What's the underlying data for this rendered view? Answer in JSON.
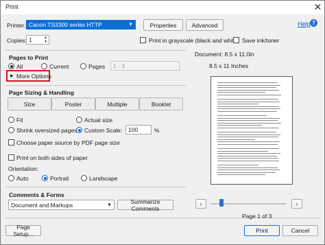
{
  "window": {
    "title": "Print",
    "close_icon": "close-icon"
  },
  "printer": {
    "label": "Printer:",
    "selected": "Canon TS3300 series HTTP",
    "properties_label": "Properties",
    "advanced_label": "Advanced",
    "help_label": "Help"
  },
  "copies": {
    "label": "Copies:",
    "value": "1",
    "grayscale_label": "Print in grayscale (black and white)",
    "save_ink_label": "Save ink/toner"
  },
  "pages_to_print": {
    "title": "Pages to Print",
    "all_label": "All",
    "current_label": "Current",
    "pages_label": "Pages",
    "pages_value": "1 - 3",
    "more_options_label": "More Options"
  },
  "sizing": {
    "title": "Page Sizing & Handling",
    "tabs": [
      "Size",
      "Poster",
      "Multiple",
      "Booklet"
    ],
    "fit_label": "Fit",
    "actual_size_label": "Actual size",
    "shrink_label": "Shrink oversized pages",
    "custom_scale_label": "Custom Scale:",
    "custom_scale_value": "100",
    "percent": "%",
    "paper_source_label": "Choose paper source by PDF page size",
    "both_sides_label": "Print on both sides of paper"
  },
  "orientation": {
    "title": "Orientation:",
    "auto_label": "Auto",
    "portrait_label": "Portrait",
    "landscape_label": "Landscape"
  },
  "comments": {
    "title": "Comments & Forms",
    "selected": "Document and Markups",
    "summarize_label": "Summarize Comments"
  },
  "preview": {
    "document_label": "Document: 8.5 x 11.0in",
    "size_label": "8.5 x 11 Inches",
    "page_indicator": "Page 1 of 3",
    "prev_icon": "chevron-left-icon",
    "next_icon": "chevron-right-icon"
  },
  "footer": {
    "page_setup_label": "Page Setup...",
    "print_label": "Print",
    "cancel_label": "Cancel"
  },
  "colors": {
    "accent": "#0d6fd6",
    "highlight_box": "#d5141b"
  }
}
